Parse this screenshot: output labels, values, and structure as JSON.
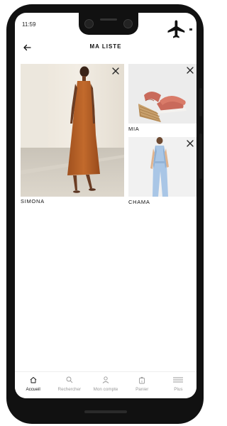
{
  "status_bar": {
    "time": "11:59"
  },
  "header": {
    "title": "MA LISTE"
  },
  "items": [
    {
      "name": "SIMONA",
      "image": "orange maxi dress"
    },
    {
      "name": "MIA",
      "image": "espadrille wedge sandal"
    },
    {
      "name": "CHAMA",
      "image": "light blue denim jumpsuit"
    }
  ],
  "tabs": [
    {
      "label": "Accueil",
      "icon": "home-icon",
      "active": true
    },
    {
      "label": "Rechercher",
      "icon": "search-icon",
      "active": false
    },
    {
      "label": "Mon compte",
      "icon": "user-icon",
      "active": false
    },
    {
      "label": "Panier",
      "icon": "bag-icon",
      "active": false
    },
    {
      "label": "Plus",
      "icon": "menu-icon",
      "active": false
    }
  ],
  "colors": {
    "accent": "#111111",
    "inactive": "#999999"
  }
}
